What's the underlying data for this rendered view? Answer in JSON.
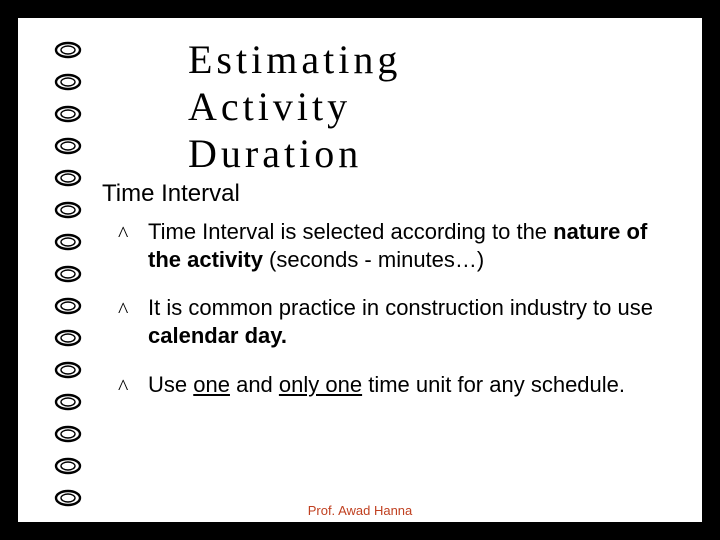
{
  "title": {
    "line1": "Estimating",
    "line2": "Activity",
    "line3": "Duration"
  },
  "section_label": "Time Interval",
  "bullets": [
    {
      "prefix": "Time Interval is selected according to the ",
      "bold": "nature of the activity",
      "suffix": " (seconds - minutes…)"
    },
    {
      "prefix": "It is common practice in construction industry to use ",
      "bold": "calendar day.",
      "suffix": ""
    },
    {
      "plain_before": "Use ",
      "u1": "one",
      "plain_mid": " and ",
      "u2": "only one",
      "plain_after": " time unit for any schedule."
    }
  ],
  "bullet_mark": "^",
  "footer": "Prof. Awad Hanna",
  "spiral_count": 15
}
